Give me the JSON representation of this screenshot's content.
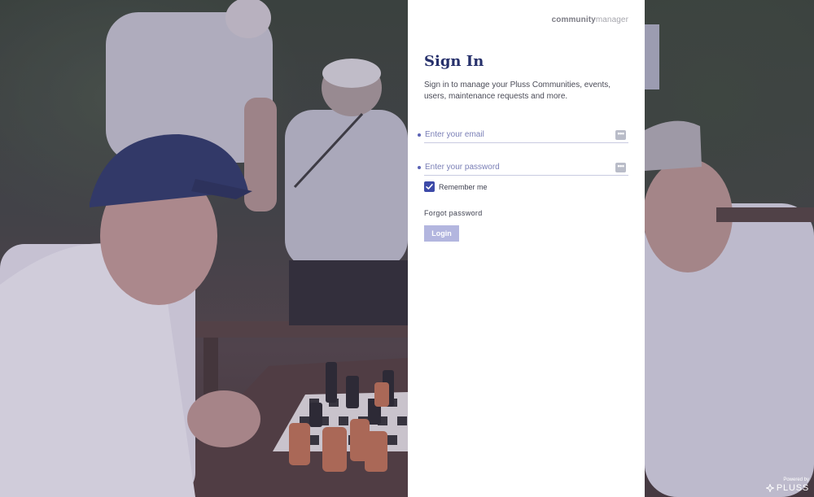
{
  "brand": {
    "bold": "community",
    "light": "manager"
  },
  "signin": {
    "title": "Sign In",
    "subtitle": "Sign in to manage your Pluss Communities, events, users, maintenance requests and more."
  },
  "form": {
    "email_placeholder": "Enter your email",
    "email_value": "",
    "password_placeholder": "Enter your password",
    "password_value": "",
    "field_button_glyph": "•••",
    "remember_label": "Remember me",
    "remember_checked": true,
    "forgot_label": "Forgot password",
    "login_label": "Login"
  },
  "footer": {
    "powered_label": "Powered by",
    "powered_brand": "PLUSS"
  },
  "icons": {
    "field_action": "ellipsis-icon",
    "checkbox": "checkmark-icon",
    "powered_logo": "pluss-logo-icon"
  },
  "colors": {
    "title": "#26306b",
    "accent": "#3d4aa8",
    "login_button": "#b3b6df",
    "panel": "#ffffff"
  }
}
